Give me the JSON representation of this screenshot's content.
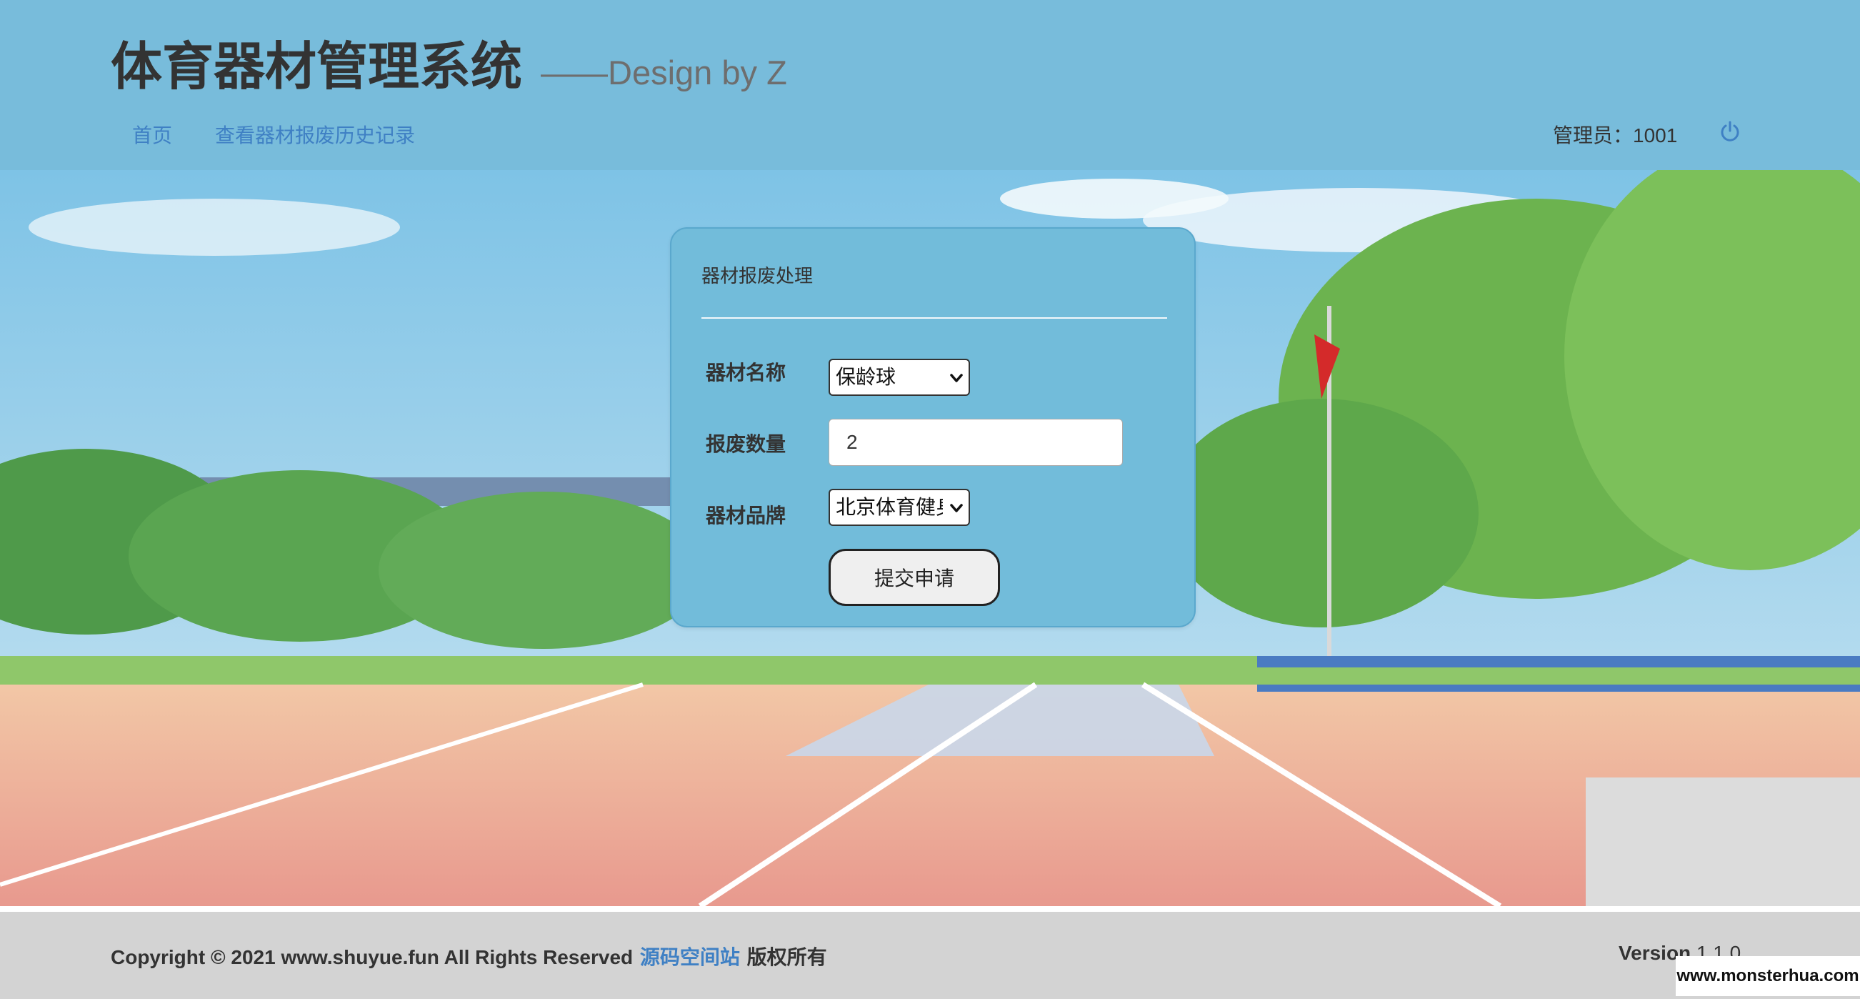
{
  "header": {
    "title": "体育器材管理系统",
    "subtitle": "——Design by Z",
    "nav": [
      {
        "label": "首页"
      },
      {
        "label": "查看器材报废历史记录"
      }
    ],
    "admin_label": "管理员：",
    "admin_id": "1001",
    "logout_icon": "power-icon"
  },
  "form": {
    "title": "器材报废处理",
    "equipment_name_label": "器材名称",
    "equipment_name_value": "保龄球",
    "quantity_label": "报废数量",
    "quantity_value": "2",
    "brand_label": "器材品牌",
    "brand_value": "北京体育健身",
    "submit_label": "提交申请"
  },
  "footer": {
    "copyright": "Copyright © 2021 www.shuyue.fun All Rights Reserved",
    "link_text": "源码空间站",
    "rights_text": "版权所有",
    "version_label": "Version",
    "version_number": "1.1.0"
  },
  "watermark": "www.monsterhua.com",
  "colors": {
    "header_bg": "#78bcdb",
    "panel_bg": "#72bcda",
    "link": "#3f80c4",
    "footer_bg": "#d3d3d3"
  }
}
